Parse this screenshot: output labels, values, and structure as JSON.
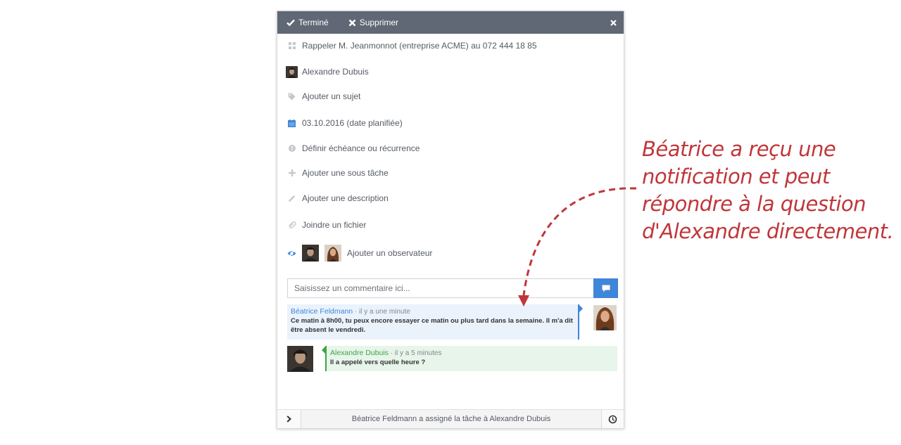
{
  "toolbar": {
    "done_label": "Terminé",
    "delete_label": "Supprimer"
  },
  "task": {
    "title": "Rappeler M. Jeanmonnot (entreprise ACME) au 072 444 18 85",
    "assignee": "Alexandre Dubuis",
    "add_subject": "Ajouter un sujet",
    "planned_date": "03.10.2016 (date planifiée)",
    "deadline": "Définir échéance ou récurrence",
    "add_subtask": "Ajouter une sous tâche",
    "add_description": "Ajouter une description",
    "attach_file": "Joindre un fichier",
    "add_observer": "Ajouter un observateur"
  },
  "comment": {
    "placeholder": "Saisissez un commentaire ici..."
  },
  "messages": [
    {
      "author": "Béatrice Feldmann",
      "time": "· il y a une minute",
      "text": "Ce matin à 8h00, tu peux encore essayer ce matin ou plus tard dans la semaine. Il m'a dit être absent le vendredi."
    },
    {
      "author": "Alexandre Dubuis",
      "time": "· il y a 5 minutes",
      "text": "Il a appelé vers quelle heure ?"
    }
  ],
  "footer": {
    "status": "Béatrice Feldmann a assigné la tâche à Alexandre Dubuis"
  },
  "annotation": {
    "lines": [
      "Béatrice a reçu une",
      "notification et peut",
      "répondre à la question",
      "d'Alexandre directement."
    ]
  },
  "colors": {
    "toolbar": "#5f6874",
    "accent_blue": "#3f86d9",
    "accent_green": "#3aa548",
    "annotation": "#c0363a"
  }
}
